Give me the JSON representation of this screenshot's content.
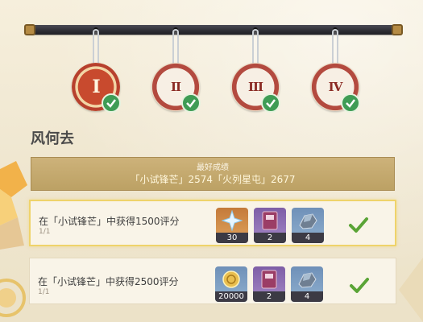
{
  "medals": [
    {
      "label": "I",
      "active": true,
      "completed": true
    },
    {
      "label": "II",
      "active": false,
      "completed": true
    },
    {
      "label": "III",
      "active": false,
      "completed": true
    },
    {
      "label": "IV",
      "active": false,
      "completed": true
    }
  ],
  "title": "风何去",
  "best": {
    "label": "最好成绩",
    "value": "「小试锋芒」2574「火列星屯」2677"
  },
  "tasks": [
    {
      "name": "在「小试锋芒」中获得1500评分",
      "count": "1/1",
      "rewards": [
        {
          "icon": "primogem-icon",
          "amount": "30"
        },
        {
          "icon": "book-icon",
          "amount": "2"
        },
        {
          "icon": "enhancement-ore-icon",
          "amount": "4"
        }
      ]
    },
    {
      "name": "在「小试锋芒」中获得2500评分",
      "count": "1/1",
      "rewards": [
        {
          "icon": "mora-icon",
          "amount": "20000"
        },
        {
          "icon": "book-icon",
          "amount": "2"
        },
        {
          "icon": "enhancement-ore-icon",
          "amount": "4"
        }
      ]
    }
  ],
  "colors": {
    "accent_gold": "#cdb27a",
    "check_green": "#3f9c55",
    "medal_red": "#b34a3f"
  }
}
